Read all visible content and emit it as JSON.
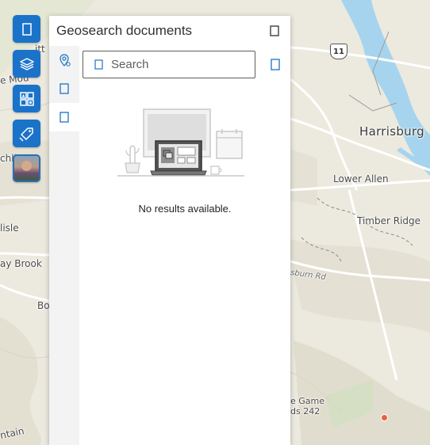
{
  "map": {
    "labels": {
      "harrisburg": "Harrisburg",
      "lower_allen": "Lower Allen",
      "timber_ridge": "Timber Ridge",
      "sburn_rd": "sburn Rd",
      "route_shield": "11",
      "lisle": "lisle",
      "ay_brook": "ay Brook",
      "bo": "Bo",
      "chli": "chli",
      "e_mou": "e Mou",
      "itt": "itt",
      "ntain": "ntain",
      "game_land_1": "e Game",
      "game_land_2": "ds 242"
    },
    "colors": {
      "background": "#ece9df",
      "river": "#a6d4ee",
      "road_major": "#ffffff",
      "poi": "#e8613a"
    }
  },
  "toolbar": {
    "buttons": [
      {
        "name": "home-button",
        "icon": "square-icon"
      },
      {
        "name": "layers-button",
        "icon": "layers-icon"
      },
      {
        "name": "basemap-gallery-button",
        "icon": "grid-icon"
      },
      {
        "name": "geosearch-button",
        "icon": "tag-icon"
      },
      {
        "name": "user-avatar-button",
        "icon": "avatar"
      }
    ],
    "accent": "#1a73c9"
  },
  "panel": {
    "title": "Geosearch documents",
    "close_icon": "close-icon",
    "rail": [
      {
        "icon": "location-gear-icon",
        "active": false
      },
      {
        "icon": "document-icon",
        "active": false
      },
      {
        "icon": "document-icon",
        "active": true
      }
    ],
    "search": {
      "placeholder": "Search",
      "value": ""
    },
    "empty_message": "No results available."
  }
}
